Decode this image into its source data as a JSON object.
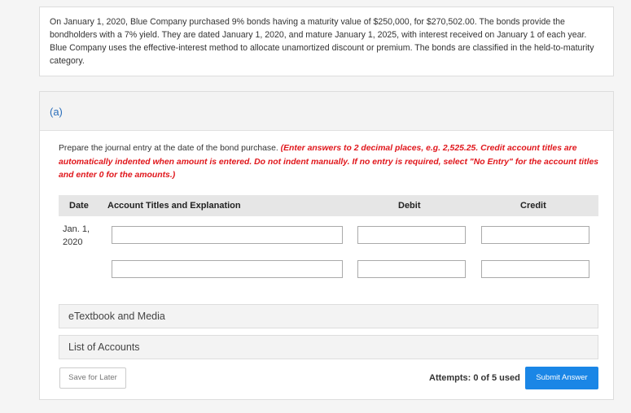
{
  "problem": {
    "text": "On January 1, 2020, Blue Company purchased 9% bonds having a maturity value of $250,000, for $270,502.00. The bonds provide the bondholders with a 7% yield. They are dated January 1, 2020, and mature January 1, 2025, with interest received on January 1 of each year. Blue Company uses the effective-interest method to allocate unamortized discount or premium. The bonds are classified in the held-to-maturity category."
  },
  "part": {
    "label": "(a)",
    "instruction": "Prepare the journal entry at the date of the bond purchase. ",
    "instruction_note": "(Enter answers to 2 decimal places, e.g. 2,525.25. Credit account titles are automatically indented when amount is entered. Do not indent manually. If no entry is required, select \"No Entry\" for the account titles and enter 0 for the amounts.)"
  },
  "table": {
    "headers": {
      "date": "Date",
      "account": "Account Titles and Explanation",
      "debit": "Debit",
      "credit": "Credit"
    },
    "rows": [
      {
        "date": "Jan. 1,\n2020",
        "account": "",
        "debit": "",
        "credit": ""
      },
      {
        "date": "",
        "account": "",
        "debit": "",
        "credit": ""
      }
    ]
  },
  "accordions": {
    "etextbook": "eTextbook and Media",
    "accounts": "List of Accounts"
  },
  "footer": {
    "save_label": "Save for Later",
    "attempts": "Attempts: 0 of 5 used",
    "submit_label": "Submit Answer"
  },
  "colors": {
    "accent": "#1a86e6",
    "note_red": "#e0161b",
    "part_label": "#2a6ebb"
  }
}
